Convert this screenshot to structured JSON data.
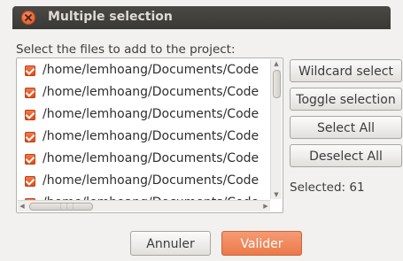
{
  "window": {
    "title": "Multiple selection"
  },
  "instruction": "Select the files to add to the project:",
  "files": [
    {
      "path": "/home/lemhoang/Documents/Code",
      "checked": true
    },
    {
      "path": "/home/lemhoang/Documents/Code",
      "checked": true
    },
    {
      "path": "/home/lemhoang/Documents/Code",
      "checked": true
    },
    {
      "path": "/home/lemhoang/Documents/Code",
      "checked": true
    },
    {
      "path": "/home/lemhoang/Documents/Code",
      "checked": true
    },
    {
      "path": "/home/lemhoang/Documents/Code",
      "checked": true
    },
    {
      "path": "/home/lemhoang/Documents/Code",
      "checked": true
    }
  ],
  "side_buttons": {
    "wildcard": "Wildcard select",
    "toggle": "Toggle selection",
    "select_all": "Select All",
    "deselect_all": "Deselect All"
  },
  "selected_label": "Selected: 61",
  "footer": {
    "cancel": "Annuler",
    "ok": "Valider"
  },
  "colors": {
    "accent": "#ec7a4a",
    "titlebar": "#3c3b37",
    "checkbox": "#df4a16"
  },
  "icons": {
    "close": "close-icon",
    "check": "check-icon"
  }
}
